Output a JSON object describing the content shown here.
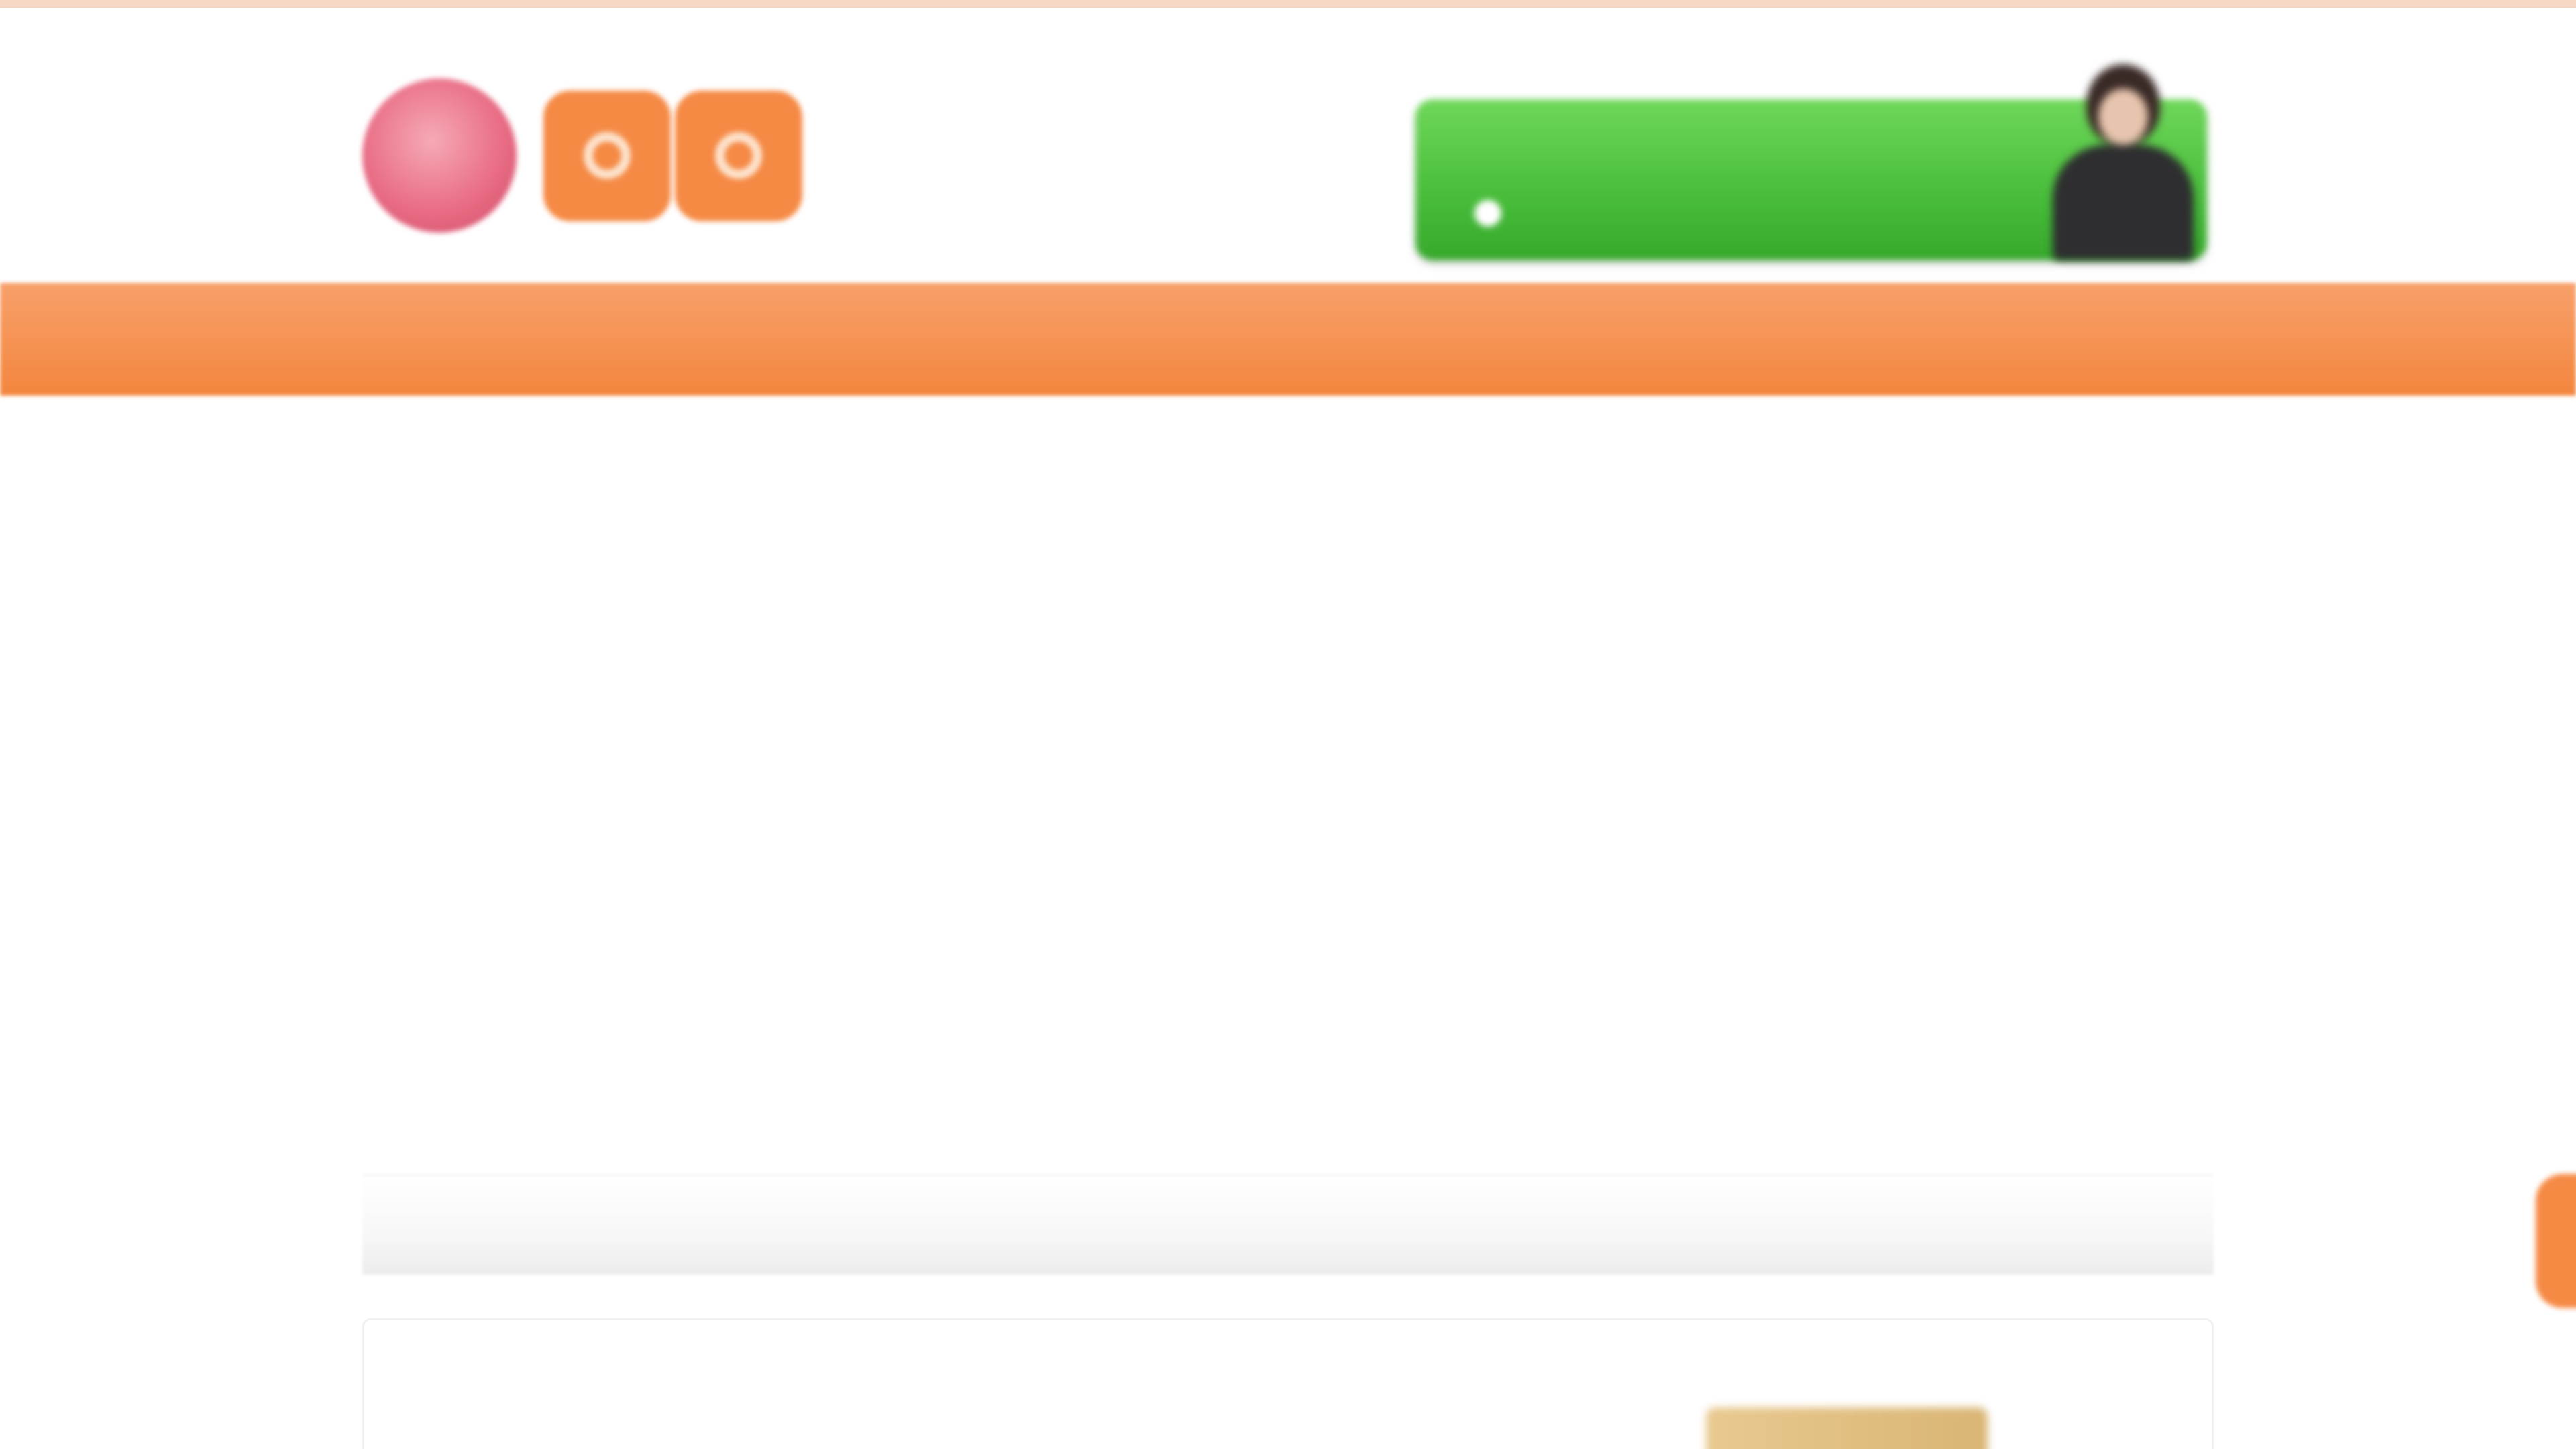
{
  "header": {
    "tagline": "",
    "logo": {
      "emblem_text": "",
      "text": "",
      "badges": [
        "",
        ""
      ]
    },
    "cta": {
      "text": "",
      "highlight": ""
    }
  },
  "nav": {
    "items": [
      {
        "label": ""
      },
      {
        "label": ""
      },
      {
        "label": ""
      },
      {
        "label": ""
      }
    ]
  },
  "main": {
    "section_title": "",
    "cards": [
      {
        "check": "",
        "title": ""
      }
    ]
  },
  "colors": {
    "accent": "#f3863e",
    "cta_green": "#4bbf3d",
    "logo_red": "#e96e86"
  }
}
